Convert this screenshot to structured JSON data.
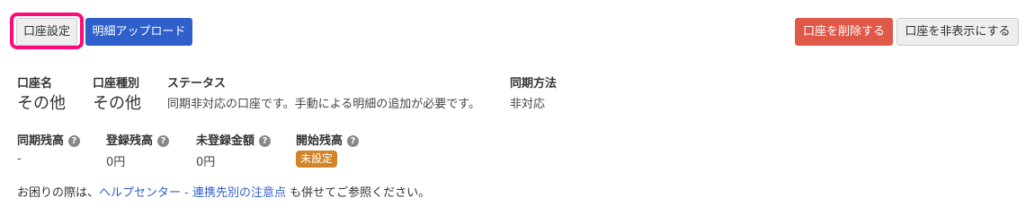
{
  "toolbar": {
    "account_settings_label": "口座設定",
    "upload_statement_label": "明細アップロード",
    "delete_account_label": "口座を削除する",
    "hide_account_label": "口座を非表示にする"
  },
  "account_info": {
    "account_name_label": "口座名",
    "account_name_value": "その他",
    "account_type_label": "口座種別",
    "account_type_value": "その他",
    "status_label": "ステータス",
    "status_value": "同期非対応の口座です。手動による明細の追加が必要です。",
    "sync_method_label": "同期方法",
    "sync_method_value": "非対応"
  },
  "balances": {
    "synced_balance_label": "同期残高",
    "synced_balance_value": "-",
    "registered_balance_label": "登録残高",
    "registered_balance_value": "0円",
    "unregistered_amount_label": "未登録金額",
    "unregistered_amount_value": "0円",
    "opening_balance_label": "開始残高",
    "opening_balance_badge": "未設定"
  },
  "help": {
    "prefix": "お困りの際は、",
    "link_text": "ヘルプセンター - 連携先別の注意点",
    "suffix": " も併せてご参照ください。",
    "icon_glyph": "?"
  },
  "colors": {
    "primary": "#2f5fcb",
    "danger": "#e05848",
    "highlight": "#ff0a78",
    "warning_badge": "#d2842a"
  }
}
